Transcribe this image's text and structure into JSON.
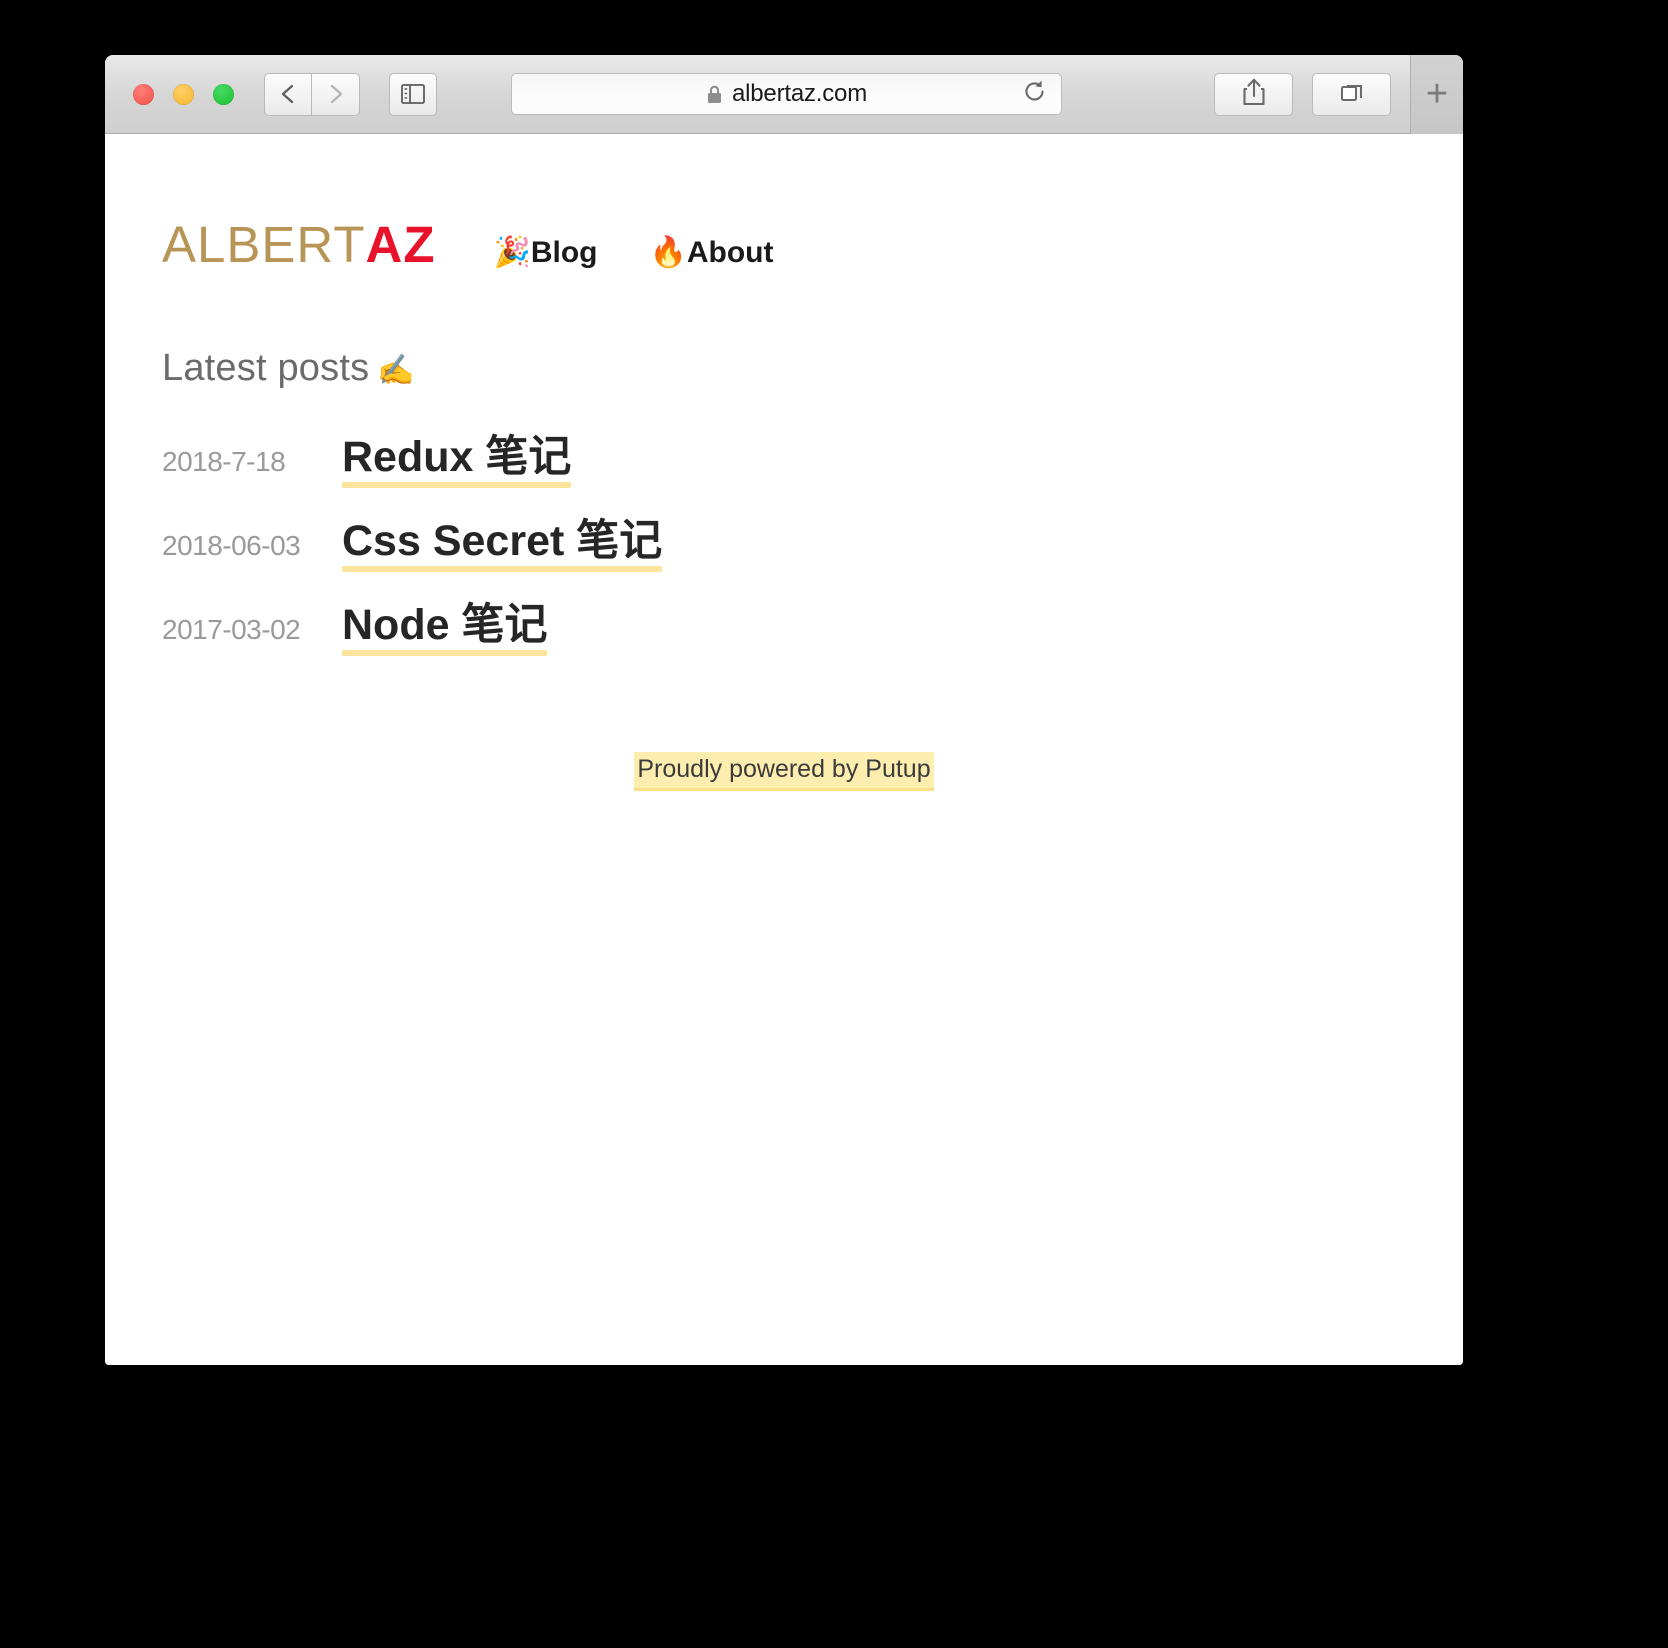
{
  "browser": {
    "url": "albertaz.com",
    "lock_icon": "lock-icon",
    "back_icon": "chevron-left-icon",
    "forward_icon": "chevron-right-icon",
    "sidebar_icon": "sidebar-icon",
    "reload_icon": "reload-icon",
    "share_icon": "share-icon",
    "tabs_icon": "tabs-overview-icon",
    "new_tab_label": "+",
    "traffic_lights": {
      "close_color": "#f75c55",
      "minimize_color": "#f7bd3f",
      "maximize_color": "#27c940"
    }
  },
  "site": {
    "logo": {
      "part_a": "ALBERT",
      "part_b": "AZ",
      "part_a_color": "#b79556",
      "part_b_color": "#e8122a"
    },
    "nav": [
      {
        "emoji": "🎉",
        "label": "Blog",
        "icon_name": "party-popper-icon"
      },
      {
        "emoji": "🔥",
        "label": "About",
        "icon_name": "fire-icon"
      }
    ],
    "heading": {
      "text": "Latest posts",
      "emoji": "✍",
      "icon_name": "writing-hand-icon"
    },
    "posts": [
      {
        "date": "2018-7-18",
        "title": "Redux 笔记"
      },
      {
        "date": "2018-06-03",
        "title": "Css Secret 笔记"
      },
      {
        "date": "2017-03-02",
        "title": "Node 笔记"
      }
    ],
    "footer": {
      "text": "Proudly powered by Putup",
      "highlight_color": "#fdeeb0"
    }
  }
}
